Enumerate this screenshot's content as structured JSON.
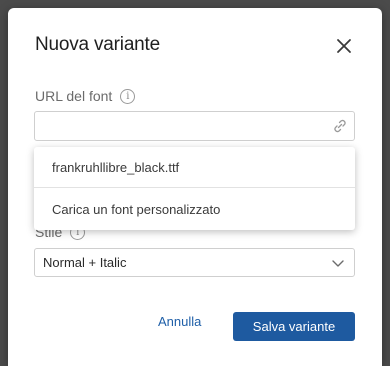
{
  "dialog": {
    "title": "Nuova variante"
  },
  "url_field": {
    "label": "URL del font",
    "value": "",
    "placeholder": ""
  },
  "font_menu": {
    "items": [
      {
        "label": "frankruhllibre_black.ttf"
      },
      {
        "label": "Carica un font personalizzato"
      }
    ]
  },
  "style_field": {
    "label": "Stile",
    "selected": "Normal + Italic"
  },
  "actions": {
    "cancel_label": "Annulla",
    "save_label": "Salva variante"
  },
  "colors": {
    "primary": "#1e5aa0",
    "link": "#1f5fa8"
  },
  "icons": {
    "close": "close-icon",
    "info": "info-icon",
    "link": "link-icon",
    "chevron": "chevron-down-icon"
  }
}
